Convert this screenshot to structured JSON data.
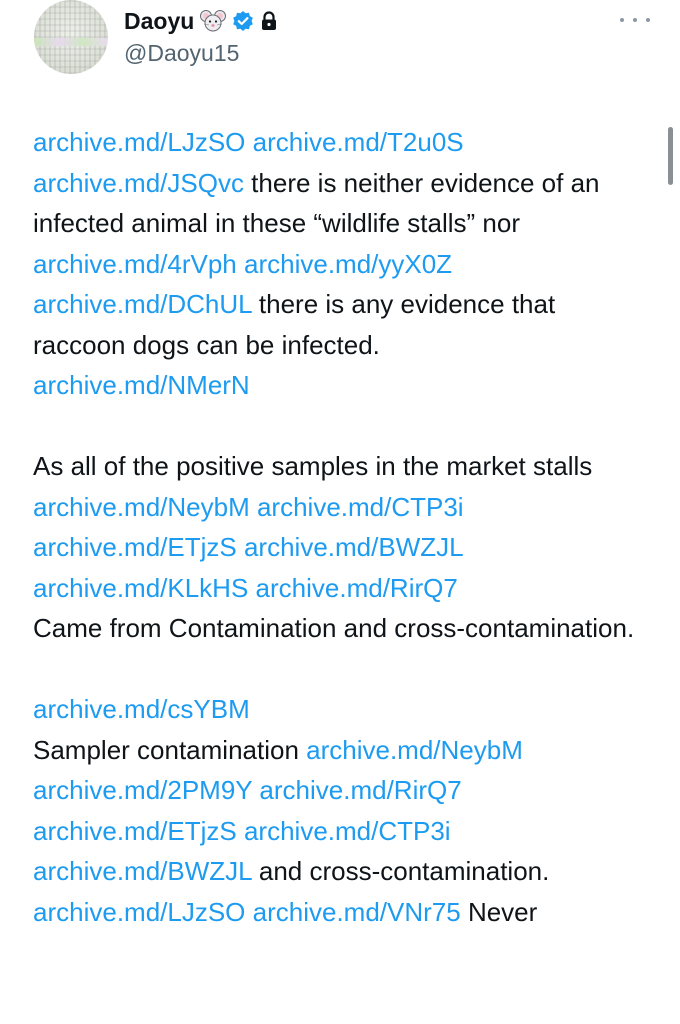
{
  "author": {
    "display_name": "Daoyu",
    "handle": "@Daoyu15",
    "emoji_icon": "mouse-face-icon",
    "verified_icon": "verified-badge-icon",
    "lock_icon": "lock-icon"
  },
  "more_icon": "more-options-icon",
  "colors": {
    "link": "#1d9bf0",
    "text": "#0f1419",
    "muted": "#536471"
  },
  "tweet": {
    "p1": {
      "l1": "archive.md/LJzSO",
      "l2": "archive.md/T2u0S",
      "l3": "archive.md/JSQvc",
      "t1": " there is neither evidence of an infected animal in these “wildlife stalls” nor ",
      "l4": "archive.md/4rVph",
      "l5": "archive.md/yyX0Z",
      "l6": "archive.md/DChUL",
      "t2": " there is any evidence that raccoon dogs can be infected.",
      "l7": "archive.md/NMerN"
    },
    "p2": {
      "t1": "As all of the positive samples in the market stalls",
      "l1": "archive.md/NeybM",
      "l2": "archive.md/CTP3i",
      "l3": "archive.md/ETjzS",
      "l4": "archive.md/BWZJL",
      "l5": "archive.md/KLkHS",
      "l6": "archive.md/RirQ7",
      "t2": "Came from Contamination and cross-contamination."
    },
    "p3": {
      "l1": "archive.md/csYBM",
      "t1": "Sampler contamination ",
      "l2": "archive.md/NeybM",
      "l3": "archive.md/2PM9Y",
      "l4": "archive.md/RirQ7",
      "l5": "archive.md/ETjzS",
      "l6": "archive.md/CTP3i",
      "l7": "archive.md/BWZJL",
      "t2": " and cross-contamination.",
      "l8": "archive.md/LJzSO",
      "l9": "archive.md/VNr75",
      "t3": " Never"
    }
  }
}
